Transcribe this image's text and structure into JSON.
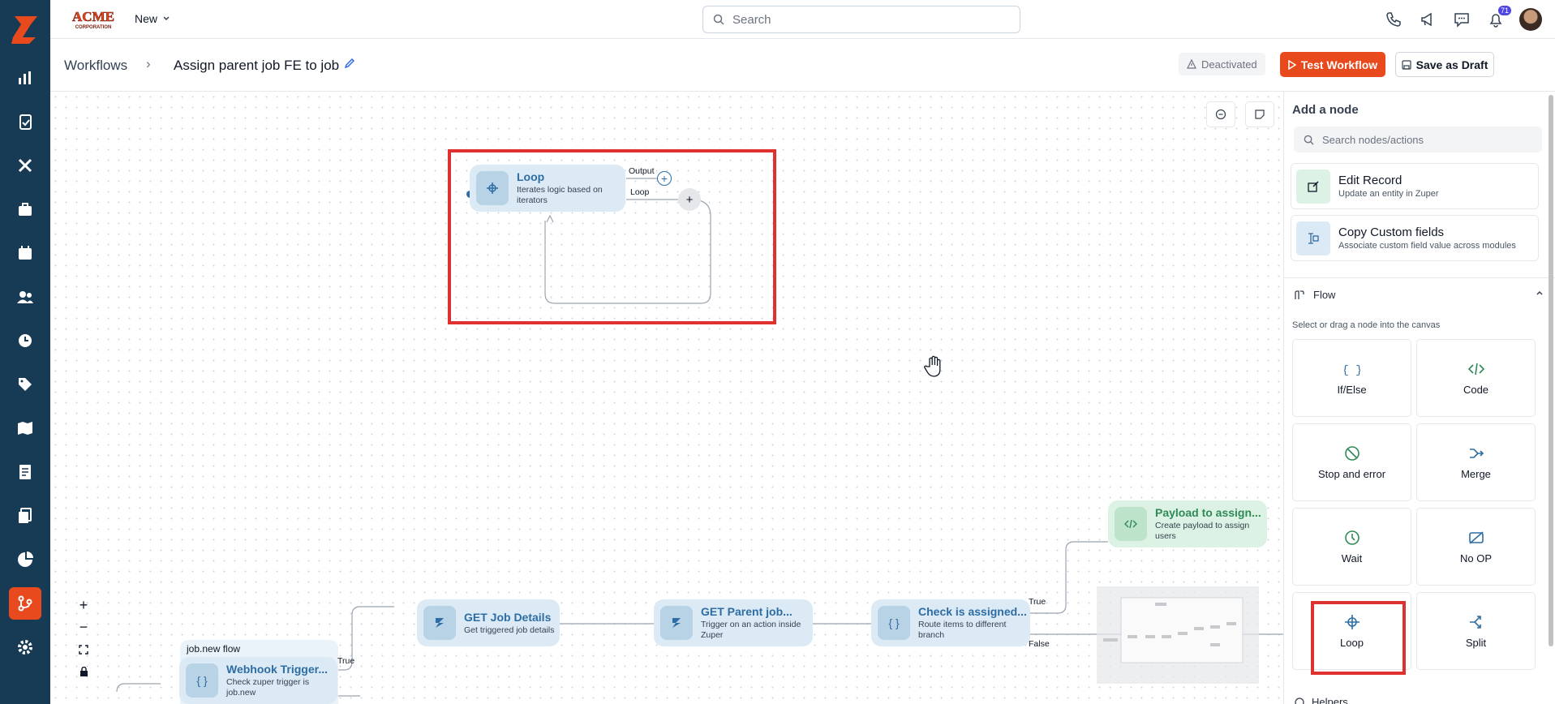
{
  "brand": {
    "accent": "#e8491d",
    "sidebar_bg": "#173a55"
  },
  "topbar": {
    "new_label": "New",
    "search_placeholder": "Search",
    "notification_count": "71"
  },
  "breadcrumb": {
    "root": "Workflows",
    "title": "Assign parent job FE to job"
  },
  "actions": {
    "status": "Deactivated",
    "test_label": "Test Workflow",
    "draft_label": "Save as Draft"
  },
  "sidebar_icons": [
    "zuper-logo",
    "dashboard-icon",
    "jobs-icon",
    "tools-icon",
    "briefcase-icon",
    "calendar-icon",
    "users-icon",
    "clock-icon",
    "tag-icon",
    "map-icon",
    "invoice-icon",
    "documents-icon",
    "reports-icon",
    "workflow-icon",
    "settings-icon"
  ],
  "canvas": {
    "loop_node": {
      "title": "Loop",
      "desc": "Iterates logic based on iterators",
      "output_label": "Output",
      "loop_label": "Loop"
    },
    "nodes": [
      {
        "title": "Webhook Trigger...",
        "desc": "Check zuper trigger is job.new",
        "group_label": "job.new flow"
      },
      {
        "title": "GET Job Details",
        "desc": "Get triggered job details"
      },
      {
        "title": "GET Parent job...",
        "desc": "Trigger on an action inside Zuper"
      },
      {
        "title": "Check is assigned...",
        "desc": "Route items to different branch"
      },
      {
        "title": "Payload to assign...",
        "desc": "Create payload to assign users"
      }
    ],
    "edge_labels": {
      "true1": "True",
      "true2": "True",
      "false": "False"
    }
  },
  "panel": {
    "title": "Add a node",
    "search_placeholder": "Search nodes/actions",
    "cards": [
      {
        "title": "Edit Record",
        "desc": "Update an entity in Zuper"
      },
      {
        "title": "Copy Custom fields",
        "desc": "Associate custom field value across modules"
      }
    ],
    "flow_section": "Flow",
    "flow_hint": "Select or drag a node into the canvas",
    "tiles": [
      "If/Else",
      "Code",
      "Stop and error",
      "Merge",
      "Wait",
      "No OP",
      "Loop",
      "Split"
    ],
    "helpers_section": "Helpers"
  }
}
